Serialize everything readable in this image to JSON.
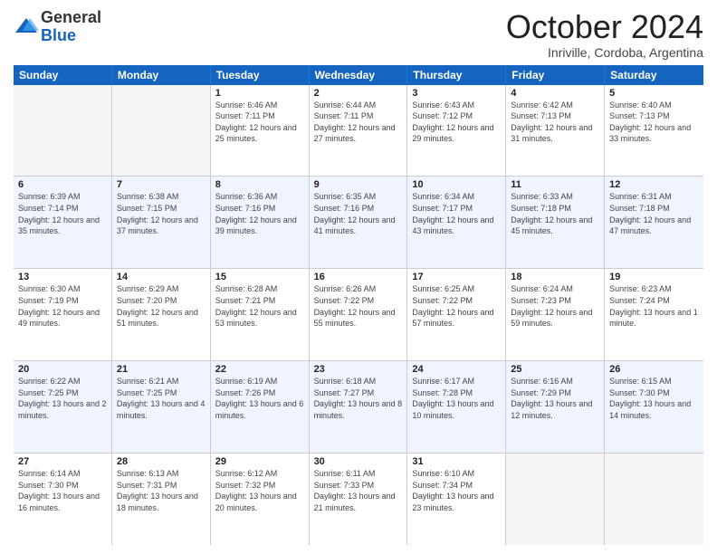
{
  "logo": {
    "general": "General",
    "blue": "Blue"
  },
  "title": "October 2024",
  "location": "Inriville, Cordoba, Argentina",
  "weekdays": [
    "Sunday",
    "Monday",
    "Tuesday",
    "Wednesday",
    "Thursday",
    "Friday",
    "Saturday"
  ],
  "weeks": [
    [
      {
        "day": "",
        "info": ""
      },
      {
        "day": "",
        "info": ""
      },
      {
        "day": "1",
        "info": "Sunrise: 6:46 AM\nSunset: 7:11 PM\nDaylight: 12 hours\nand 25 minutes."
      },
      {
        "day": "2",
        "info": "Sunrise: 6:44 AM\nSunset: 7:11 PM\nDaylight: 12 hours\nand 27 minutes."
      },
      {
        "day": "3",
        "info": "Sunrise: 6:43 AM\nSunset: 7:12 PM\nDaylight: 12 hours\nand 29 minutes."
      },
      {
        "day": "4",
        "info": "Sunrise: 6:42 AM\nSunset: 7:13 PM\nDaylight: 12 hours\nand 31 minutes."
      },
      {
        "day": "5",
        "info": "Sunrise: 6:40 AM\nSunset: 7:13 PM\nDaylight: 12 hours\nand 33 minutes."
      }
    ],
    [
      {
        "day": "6",
        "info": "Sunrise: 6:39 AM\nSunset: 7:14 PM\nDaylight: 12 hours\nand 35 minutes."
      },
      {
        "day": "7",
        "info": "Sunrise: 6:38 AM\nSunset: 7:15 PM\nDaylight: 12 hours\nand 37 minutes."
      },
      {
        "day": "8",
        "info": "Sunrise: 6:36 AM\nSunset: 7:16 PM\nDaylight: 12 hours\nand 39 minutes."
      },
      {
        "day": "9",
        "info": "Sunrise: 6:35 AM\nSunset: 7:16 PM\nDaylight: 12 hours\nand 41 minutes."
      },
      {
        "day": "10",
        "info": "Sunrise: 6:34 AM\nSunset: 7:17 PM\nDaylight: 12 hours\nand 43 minutes."
      },
      {
        "day": "11",
        "info": "Sunrise: 6:33 AM\nSunset: 7:18 PM\nDaylight: 12 hours\nand 45 minutes."
      },
      {
        "day": "12",
        "info": "Sunrise: 6:31 AM\nSunset: 7:18 PM\nDaylight: 12 hours\nand 47 minutes."
      }
    ],
    [
      {
        "day": "13",
        "info": "Sunrise: 6:30 AM\nSunset: 7:19 PM\nDaylight: 12 hours\nand 49 minutes."
      },
      {
        "day": "14",
        "info": "Sunrise: 6:29 AM\nSunset: 7:20 PM\nDaylight: 12 hours\nand 51 minutes."
      },
      {
        "day": "15",
        "info": "Sunrise: 6:28 AM\nSunset: 7:21 PM\nDaylight: 12 hours\nand 53 minutes."
      },
      {
        "day": "16",
        "info": "Sunrise: 6:26 AM\nSunset: 7:22 PM\nDaylight: 12 hours\nand 55 minutes."
      },
      {
        "day": "17",
        "info": "Sunrise: 6:25 AM\nSunset: 7:22 PM\nDaylight: 12 hours\nand 57 minutes."
      },
      {
        "day": "18",
        "info": "Sunrise: 6:24 AM\nSunset: 7:23 PM\nDaylight: 12 hours\nand 59 minutes."
      },
      {
        "day": "19",
        "info": "Sunrise: 6:23 AM\nSunset: 7:24 PM\nDaylight: 13 hours\nand 1 minute."
      }
    ],
    [
      {
        "day": "20",
        "info": "Sunrise: 6:22 AM\nSunset: 7:25 PM\nDaylight: 13 hours\nand 2 minutes."
      },
      {
        "day": "21",
        "info": "Sunrise: 6:21 AM\nSunset: 7:25 PM\nDaylight: 13 hours\nand 4 minutes."
      },
      {
        "day": "22",
        "info": "Sunrise: 6:19 AM\nSunset: 7:26 PM\nDaylight: 13 hours\nand 6 minutes."
      },
      {
        "day": "23",
        "info": "Sunrise: 6:18 AM\nSunset: 7:27 PM\nDaylight: 13 hours\nand 8 minutes."
      },
      {
        "day": "24",
        "info": "Sunrise: 6:17 AM\nSunset: 7:28 PM\nDaylight: 13 hours\nand 10 minutes."
      },
      {
        "day": "25",
        "info": "Sunrise: 6:16 AM\nSunset: 7:29 PM\nDaylight: 13 hours\nand 12 minutes."
      },
      {
        "day": "26",
        "info": "Sunrise: 6:15 AM\nSunset: 7:30 PM\nDaylight: 13 hours\nand 14 minutes."
      }
    ],
    [
      {
        "day": "27",
        "info": "Sunrise: 6:14 AM\nSunset: 7:30 PM\nDaylight: 13 hours\nand 16 minutes."
      },
      {
        "day": "28",
        "info": "Sunrise: 6:13 AM\nSunset: 7:31 PM\nDaylight: 13 hours\nand 18 minutes."
      },
      {
        "day": "29",
        "info": "Sunrise: 6:12 AM\nSunset: 7:32 PM\nDaylight: 13 hours\nand 20 minutes."
      },
      {
        "day": "30",
        "info": "Sunrise: 6:11 AM\nSunset: 7:33 PM\nDaylight: 13 hours\nand 21 minutes."
      },
      {
        "day": "31",
        "info": "Sunrise: 6:10 AM\nSunset: 7:34 PM\nDaylight: 13 hours\nand 23 minutes."
      },
      {
        "day": "",
        "info": ""
      },
      {
        "day": "",
        "info": ""
      }
    ]
  ],
  "alt_rows": [
    1,
    3
  ]
}
